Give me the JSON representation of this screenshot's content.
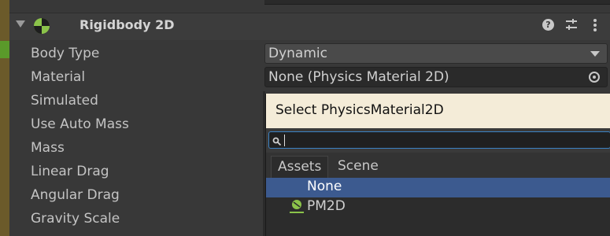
{
  "component": {
    "title": "Rigidbody 2D",
    "colors": {
      "header_icon": "#8bc34a",
      "selection": "#3c5a8f",
      "popup_title_bg": "#f4ecd8"
    }
  },
  "properties": [
    {
      "label": "Body Type"
    },
    {
      "label": "Material"
    },
    {
      "label": "Simulated"
    },
    {
      "label": "Use Auto Mass"
    },
    {
      "label": "Mass"
    },
    {
      "label": "Linear Drag"
    },
    {
      "label": "Angular Drag"
    },
    {
      "label": "Gravity Scale"
    }
  ],
  "fields": {
    "body_type": "Dynamic",
    "material": "None (Physics Material 2D)"
  },
  "picker": {
    "title": "Select PhysicsMaterial2D",
    "search_value": "",
    "tabs": [
      "Assets",
      "Scene"
    ],
    "active_tab": "Assets",
    "items": [
      {
        "label": "None",
        "selected": true
      },
      {
        "label": "PM2D",
        "selected": false
      }
    ]
  }
}
